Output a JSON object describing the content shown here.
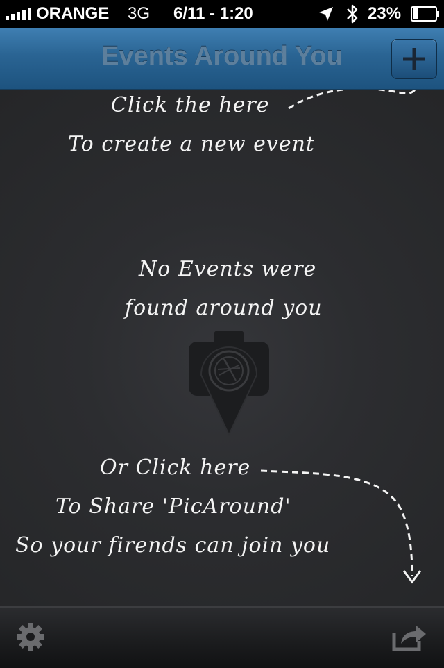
{
  "status_bar": {
    "carrier": "ORANGE",
    "network": "3G",
    "time": "6/11 - 1:20",
    "battery_percent": "23%",
    "battery_level": 0.23,
    "icons": [
      "signal-icon",
      "location-icon",
      "bluetooth-icon",
      "battery-icon"
    ]
  },
  "navbar": {
    "title": "Events Around You",
    "add_icon": "plus-icon"
  },
  "hints": {
    "create_line1": "Click the  here",
    "create_line2": "To create a new event",
    "empty_line1": "No Events were",
    "empty_line2": "found around you",
    "share_line1": "Or Click here",
    "share_line2": "To Share 'PicAround'",
    "share_line3": "So your firends can join you"
  },
  "toolbar": {
    "left_icon": "gear-icon",
    "right_icon": "share-icon"
  },
  "colors": {
    "navbar": "#2a6493",
    "background": "#2b2c2f",
    "hint_text": "#f4f4f4"
  }
}
